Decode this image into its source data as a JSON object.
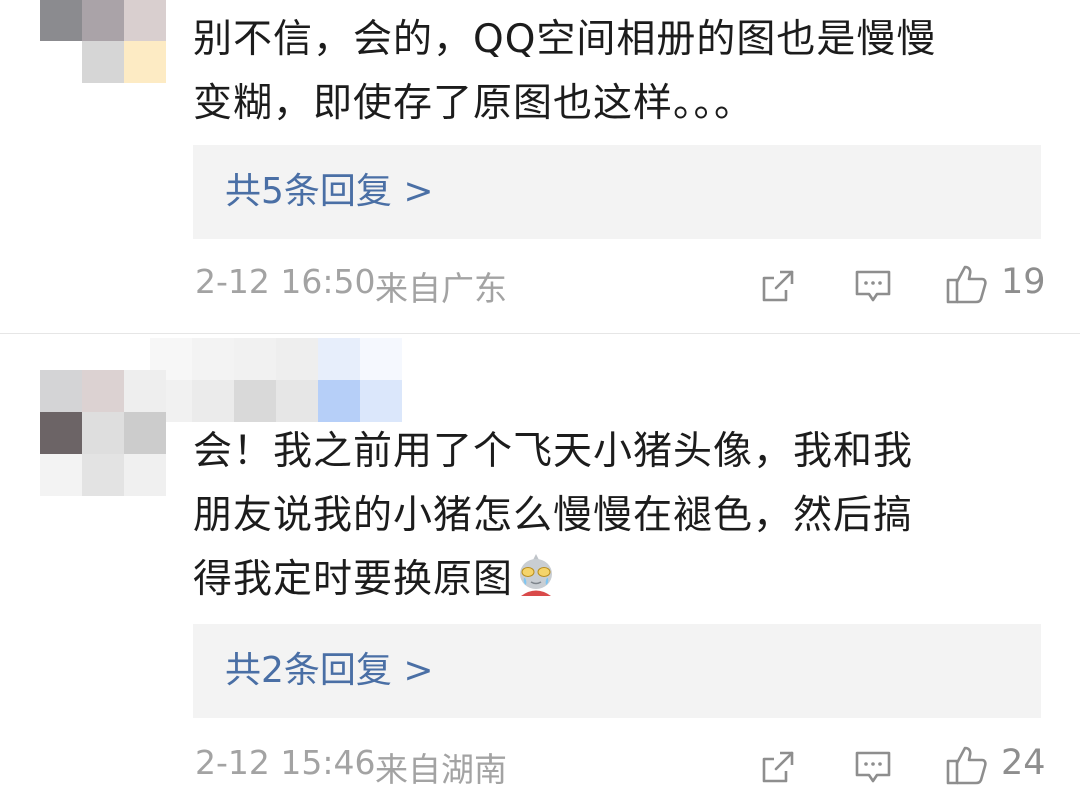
{
  "comments": [
    {
      "text_line1": "别不信，会的，QQ空间相册的图也是慢慢",
      "text_line2": "变糊，即使存了原图也这样。。。",
      "reply_link": "共5条回复 >",
      "time": "2-12 16:50",
      "location": "来自广东",
      "likes": "19"
    },
    {
      "text_line1": "会！我之前用了个飞天小猪头像，我和我",
      "text_line2": "朋友说我的小猪怎么慢慢在褪色，然后搞",
      "text_line3": "得我定时要换原图",
      "reply_link": "共2条回复 >",
      "time": "2-12 15:46",
      "location": "来自湖南",
      "likes": "24"
    }
  ],
  "colors": {
    "link": "#4a6fa5",
    "meta": "#a3a3a3",
    "reply_bg": "#f3f3f3"
  },
  "icons": [
    "share-icon",
    "comment-icon",
    "like-icon",
    "ultraman-emoji"
  ]
}
